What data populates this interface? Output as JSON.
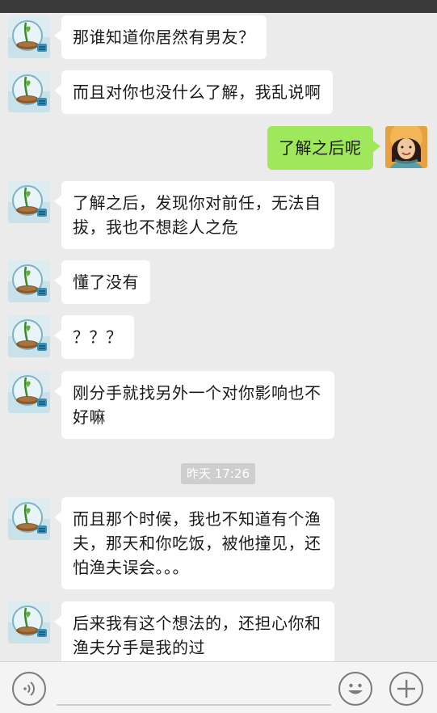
{
  "messages": [
    {
      "side": "left",
      "text": "那谁知道你居然有男友？"
    },
    {
      "side": "left",
      "text": "而且对你也没什么了解，我乱说啊"
    },
    {
      "side": "right",
      "text": "了解之后呢"
    },
    {
      "side": "left",
      "text": "了解之后，发现你对前任，无法自拔，我也不想趁人之危"
    },
    {
      "side": "left",
      "text": "懂了没有"
    },
    {
      "side": "left",
      "text": "？？？"
    },
    {
      "side": "left",
      "text": "刚分手就找另外一个对你影响也不好嘛"
    },
    {
      "side": "left",
      "text": "而且那个时候，我也不知道有个渔夫，那天和你吃饭，被他撞见，还怕渔夫误会。。。"
    },
    {
      "side": "left",
      "text": "后来我有这个想法的，还担心你和渔夫分手是我的过"
    }
  ],
  "timestamp": "昨天 17:26",
  "input_bar": {
    "voice_icon": "voice-icon",
    "emoji_icon": "emoji-icon",
    "plus_icon": "plus-icon"
  },
  "colors": {
    "background": "#ebebeb",
    "bubble_left": "#ffffff",
    "bubble_right": "#9fe75b",
    "status_bar": "#3a3a3a"
  }
}
